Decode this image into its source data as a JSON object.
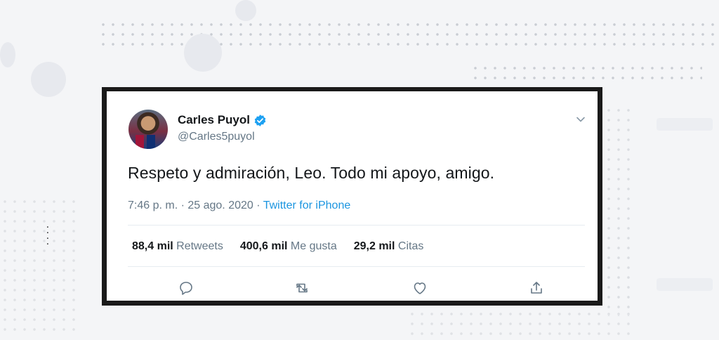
{
  "tweet": {
    "author_name": "Carles Puyol",
    "handle": "@Carles5puyol",
    "text": "Respeto y admiración, Leo. Todo mi apoyo, amigo.",
    "timestamp": "7:46 p. m. · 25 ago. 2020",
    "separator": " · ",
    "source": "Twitter for iPhone",
    "stats": [
      {
        "value": "88,4 mil",
        "label": "Retweets"
      },
      {
        "value": "400,6 mil",
        "label": "Me gusta"
      },
      {
        "value": "29,2 mil",
        "label": "Citas"
      }
    ],
    "icons": {
      "verified": "verified-badge-icon",
      "menu": "chevron-down-icon",
      "reply": "reply-icon",
      "retweet": "retweet-icon",
      "like": "heart-icon",
      "share": "share-icon"
    }
  },
  "colors": {
    "accent": "#1b95e0",
    "frame": "#1a1a1a",
    "muted_text": "#657786",
    "primary_text": "#14171a"
  }
}
